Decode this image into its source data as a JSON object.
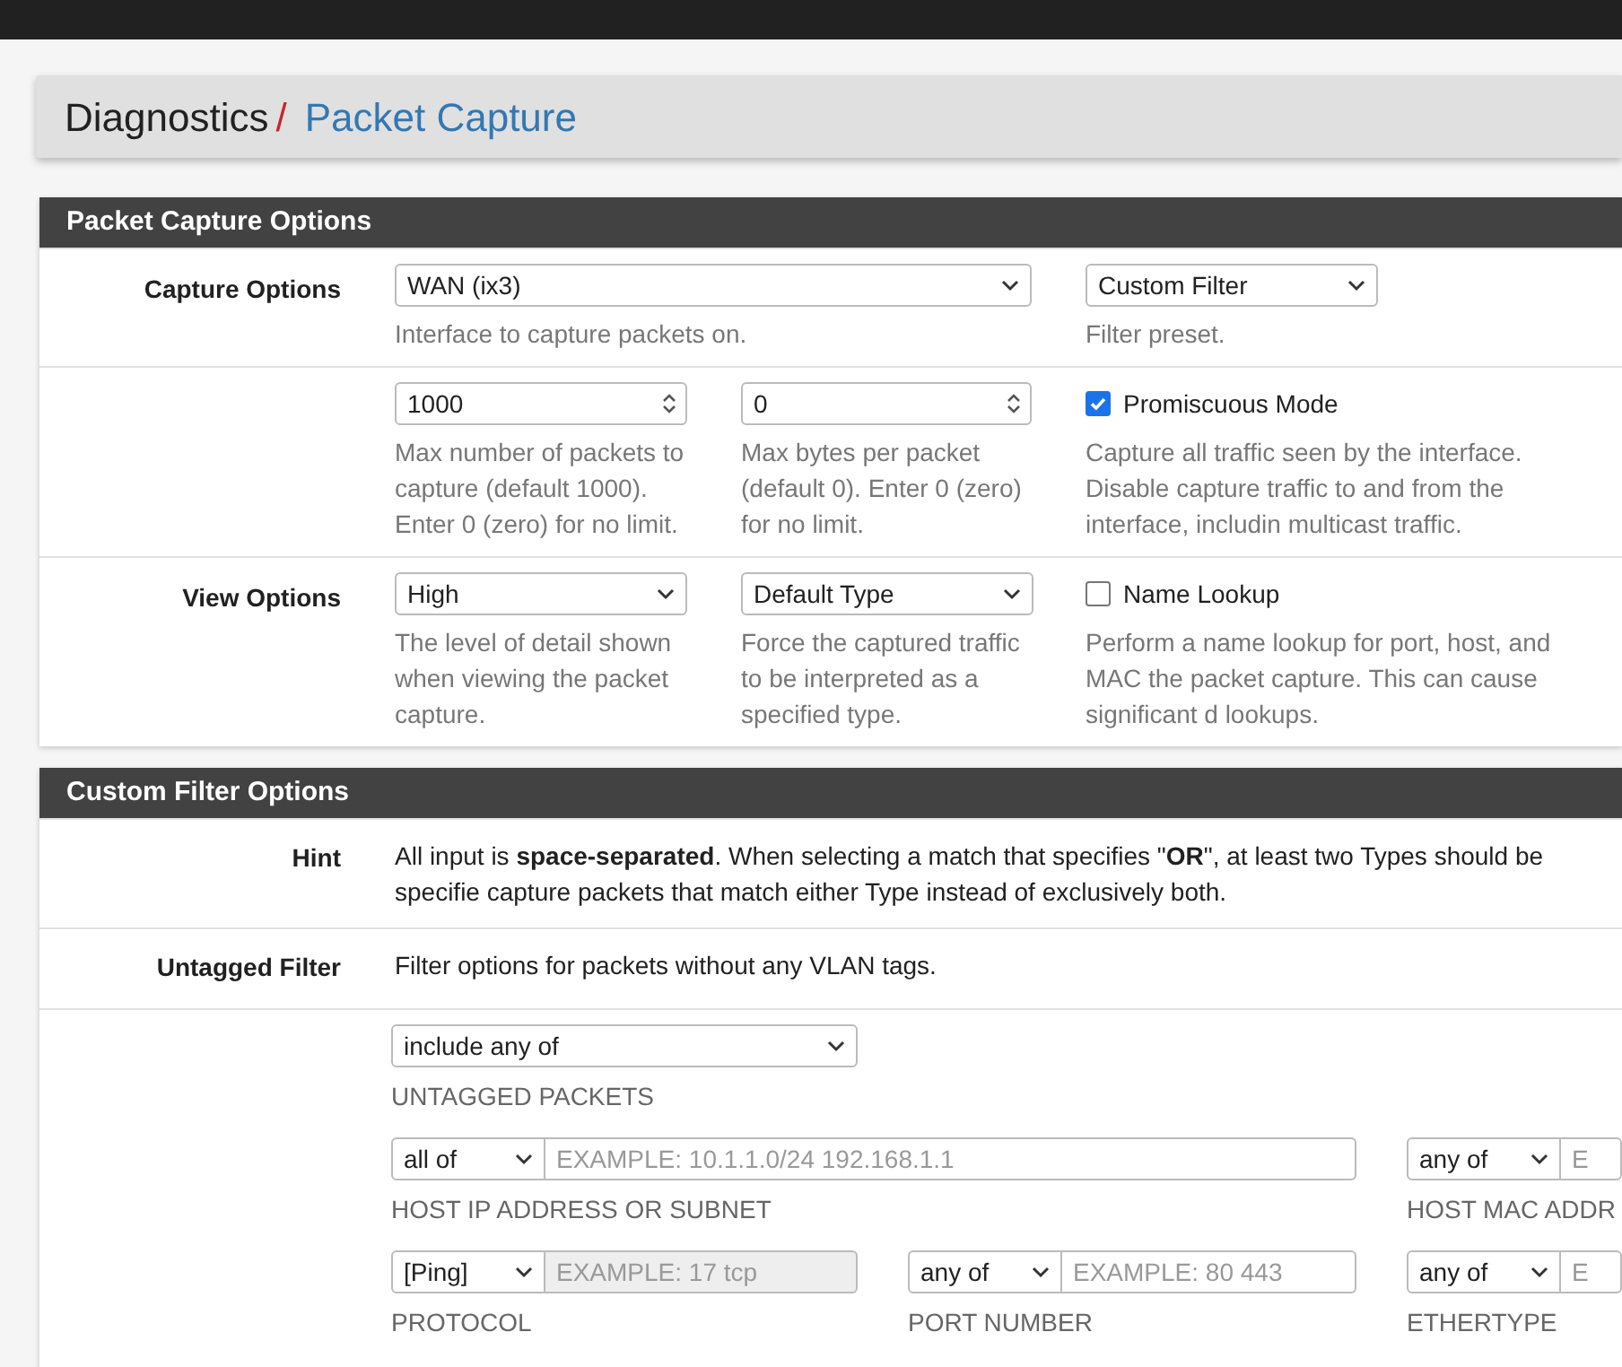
{
  "breadcrumb": {
    "section": "Diagnostics",
    "separator": "/",
    "page": "Packet Capture"
  },
  "capture_panel": {
    "title": "Packet Capture Options",
    "rows": [
      {
        "label": "Capture Options",
        "cells": [
          {
            "kind": "wide_select",
            "value": "WAN (ix3)",
            "help": "Interface to capture packets on."
          },
          "",
          {
            "kind": "select",
            "value": "Custom Filter",
            "help": "Filter preset."
          }
        ]
      },
      {
        "cells": [
          {
            "kind": "number",
            "value": "1000",
            "help": "Max number of packets to capture (default 1000). Enter 0 (zero) for no limit."
          },
          {
            "kind": "number",
            "value": "0",
            "help": "Max bytes per packet (default 0). Enter 0 (zero) for no limit."
          },
          {
            "kind": "checkbox",
            "label": "Promiscuous Mode",
            "checked": true,
            "help": "Capture all traffic seen by the interface. Disable capture traffic to and from the interface, includin multicast traffic."
          }
        ]
      },
      {
        "label": "View Options",
        "cells": [
          {
            "kind": "select",
            "value": "High",
            "help": "The level of detail shown when viewing the packet capture."
          },
          {
            "kind": "select",
            "value": "Default Type",
            "help": "Force the captured traffic to be interpreted as a specified type."
          },
          {
            "kind": "checkbox",
            "label": "Name Lookup",
            "checked": false,
            "help": "Perform a name lookup for port, host, and MAC the packet capture. This can cause significant d lookups."
          }
        ]
      }
    ]
  },
  "filter_panel": {
    "title": "Custom Filter Options",
    "rows": [
      {
        "kind": "text",
        "label": "Hint",
        "text": "All input is **space-separated**. When selecting a match that specifies \"**OR**\", at least two Types should be specifie capture packets that match either Type instead of exclusively both."
      },
      {
        "kind": "text",
        "label": "Untagged Filter",
        "text": "Filter options for packets without any VLAN tags."
      },
      {
        "kind": "fields",
        "lines": [
          [
            {
              "kind": "select",
              "value": "include any of",
              "caption": "UNTAGGED PACKETS"
            }
          ],
          [
            {
              "kind": "wide_combo",
              "value": "all of",
              "placeholder": "EXAMPLE: 10.1.1.0/24 192.168.1.1",
              "disabled": false,
              "caption": "HOST IP ADDRESS OR SUBNET"
            },
            {
              "kind": "combo",
              "value": "any of",
              "placeholder": "E",
              "disabled": false,
              "caption": "HOST MAC ADDR"
            }
          ],
          [
            {
              "kind": "combo",
              "value": "[Ping]",
              "placeholder": "EXAMPLE: 17 tcp",
              "disabled": true,
              "caption": "PROTOCOL"
            },
            {
              "kind": "combo",
              "value": "any of",
              "placeholder": "EXAMPLE: 80 443",
              "disabled": false,
              "caption": "PORT NUMBER"
            },
            {
              "kind": "combo",
              "value": "any of",
              "placeholder": "E",
              "disabled": false,
              "caption": "ETHERTYPE"
            }
          ]
        ]
      }
    ]
  }
}
